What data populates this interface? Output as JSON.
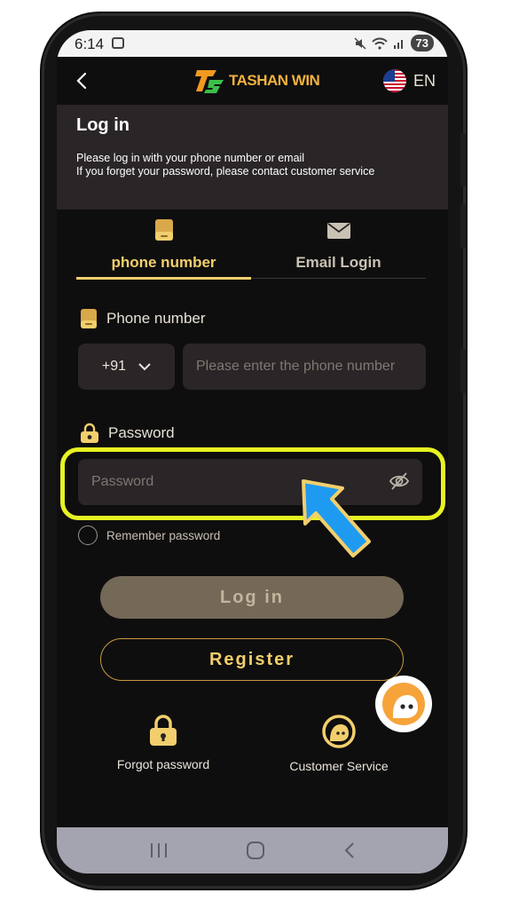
{
  "status_bar": {
    "time": "6:14",
    "battery": "73",
    "icons": [
      "screenshot-icon",
      "mute-icon",
      "wifi-icon",
      "signal-icon",
      "battery-icon"
    ]
  },
  "header": {
    "logo_text": "TASHAN WIN",
    "logo_emblem": "TS",
    "language": "EN",
    "icons": [
      "back-arrow-icon",
      "us-flag-icon"
    ]
  },
  "intro": {
    "title": "Log in",
    "line1": "Please log in with your phone number or email",
    "line2": "If you forget your password, please contact customer service"
  },
  "tabs": [
    {
      "label": "phone number",
      "icon": "phone-icon",
      "active": true
    },
    {
      "label": "Email Login",
      "icon": "envelope-icon",
      "active": false
    }
  ],
  "form": {
    "phone_label": "Phone number",
    "country_code": "+91",
    "phone_placeholder": "Please enter the phone number",
    "password_label": "Password",
    "password_placeholder": "Password",
    "remember_label": "Remember password"
  },
  "buttons": {
    "login": "Log in",
    "register": "Register"
  },
  "links": {
    "forgot": "Forgot password",
    "service": "Customer Service"
  },
  "colors": {
    "accent_gold": "#f2cf6c",
    "highlight": "#e6f321",
    "arrow": "#1e9bf0",
    "background": "#0f0e0f",
    "panel": "#2a2526"
  }
}
